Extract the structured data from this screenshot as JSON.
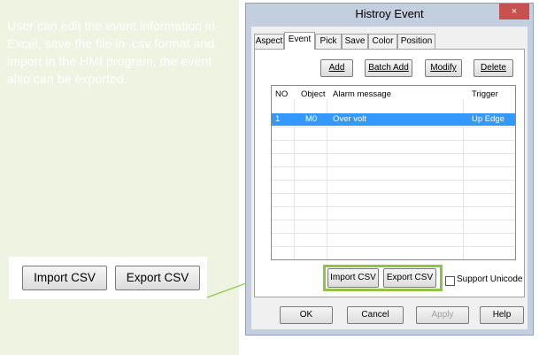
{
  "description": "User can edit the event information in Excel, save the file in .csv format and import in the HMI program, the event also can be exported.",
  "callout": {
    "import_label": "Import CSV",
    "export_label": "Export CSV"
  },
  "dialog": {
    "title": "Histroy Event",
    "close_label": "×",
    "tabs": [
      {
        "label": "Aspect"
      },
      {
        "label": "Event"
      },
      {
        "label": "Pick"
      },
      {
        "label": "Save"
      },
      {
        "label": "Color"
      },
      {
        "label": "Position"
      }
    ],
    "toolbar": {
      "add": "Add",
      "batch_add": "Batch Add",
      "modify": "Modify",
      "delete": "Delete"
    },
    "table": {
      "columns": [
        "NO",
        "Object",
        "Alarm message",
        "Trigger"
      ],
      "rows": [
        {
          "no": "1",
          "object": "M0",
          "message": "Over volt",
          "trigger": "Up Edge"
        }
      ]
    },
    "import_label": "Import CSV",
    "export_label": "Export CSV",
    "support_unicode_label": "Support Unicode",
    "buttons": {
      "ok": "OK",
      "cancel": "Cancel",
      "apply": "Apply",
      "help": "Help"
    }
  },
  "colors": {
    "highlight": "#8cc63f",
    "selection": "#3399ff",
    "panel": "#eef3e2",
    "close": "#c75050"
  }
}
